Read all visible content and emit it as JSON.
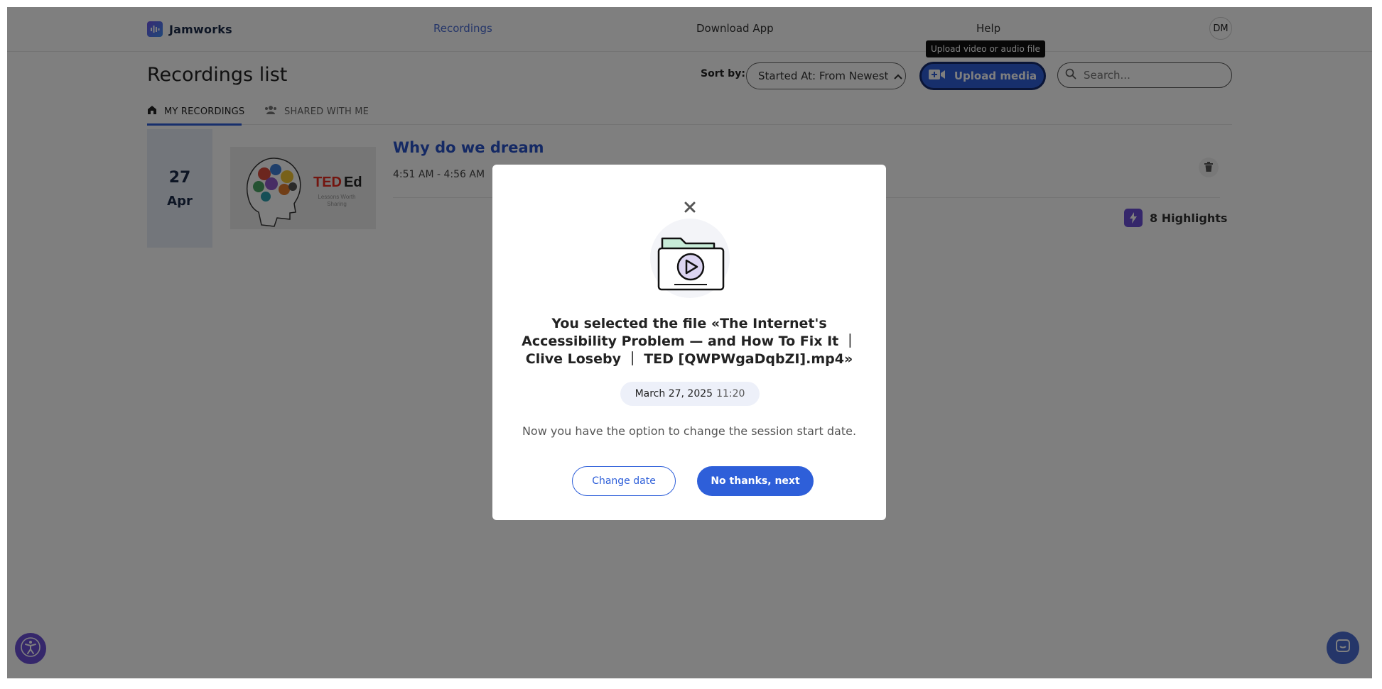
{
  "nav": {
    "brand": "Jamworks",
    "links": [
      {
        "label": "Recordings",
        "active": true
      },
      {
        "label": "Download App",
        "active": false
      },
      {
        "label": "Help",
        "active": false
      }
    ],
    "avatar_initials": "DM"
  },
  "header": {
    "title": "Recordings list",
    "sort_label": "Sort by:",
    "sort_value": "Started At: From Newest",
    "upload_label": "Upload media",
    "upload_tooltip": "Upload video or audio file",
    "search_placeholder": "Search..."
  },
  "tabs": [
    {
      "label": "MY RECORDINGS",
      "icon": "home-icon",
      "active": true
    },
    {
      "label": "SHARED WITH ME",
      "icon": "users-icon",
      "active": false
    }
  ],
  "recordings": [
    {
      "day": "27",
      "month": "Apr",
      "title": "Why do we dream",
      "time": "4:51 AM - 4:56 AM",
      "thumbnail_brand": "TEDEd",
      "thumbnail_tagline": "Lessons Worth Sharing",
      "highlights": "8 Highlights"
    }
  ],
  "modal": {
    "title": "You selected the file «The Internet's Accessibility Problem — and How To Fix It ｜ Clive Loseby ｜ TED [QWPWgaDqbZI].mp4»",
    "date": "March 27, 2025",
    "time": "11:20",
    "description": "Now you have the option to change the session start date.",
    "change_date_label": "Change date",
    "next_label": "No thanks, next"
  },
  "colors": {
    "primary": "#2e5fd9",
    "accent_purple": "#6a4ed6",
    "overlay": "rgba(0,0,0,0.5)"
  }
}
